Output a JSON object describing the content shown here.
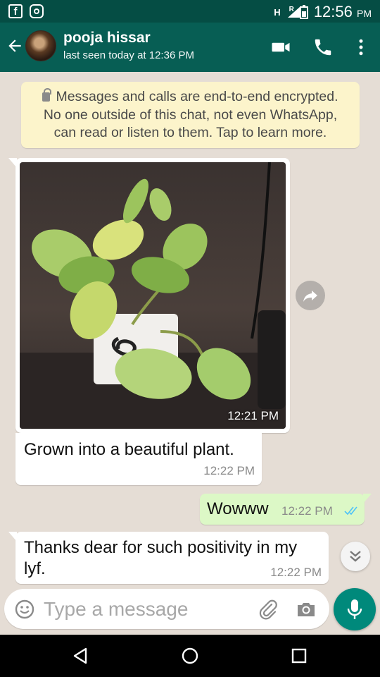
{
  "status_bar": {
    "signal_label": "H",
    "roaming_label": "R",
    "time": "12:56",
    "ampm": "PM"
  },
  "header": {
    "contact_name": "pooja hissar",
    "last_seen": "last seen today at 12:36 PM"
  },
  "encryption_notice": {
    "line1": "Messages and calls are end-to-end encrypted.",
    "line2": "No one outside of this chat, not even WhatsApp,",
    "line3": "can read or listen to them. Tap to learn more."
  },
  "messages": [
    {
      "type": "image",
      "direction": "incoming",
      "time": "12:21 PM"
    },
    {
      "type": "text",
      "direction": "incoming",
      "text": "Grown into a beautiful plant.",
      "time": "12:22 PM"
    },
    {
      "type": "text",
      "direction": "outgoing",
      "text": "Wowww",
      "time": "12:22 PM",
      "status": "read"
    },
    {
      "type": "text",
      "direction": "incoming",
      "text": "Thanks dear for such positivity in my lyf.",
      "time": "12:22 PM"
    }
  ],
  "composer": {
    "placeholder": "Type a message"
  },
  "colors": {
    "header": "#075e54",
    "status_bar": "#054d44",
    "chat_background": "#e5ddd5",
    "outgoing_bubble": "#dcf8c6",
    "incoming_bubble": "#ffffff",
    "notice_background": "#fcf4cb",
    "mic_button": "#00897b",
    "read_ticks": "#4fc3f7"
  },
  "icons": {
    "status_left": [
      "facebook-icon",
      "instagram-icon"
    ],
    "header_actions": [
      "video-call-icon",
      "voice-call-icon",
      "more-options-icon"
    ],
    "composer": [
      "emoji-icon",
      "attach-icon",
      "camera-icon",
      "mic-icon"
    ],
    "navigation": [
      "back-nav-icon",
      "home-nav-icon",
      "recents-nav-icon"
    ]
  }
}
